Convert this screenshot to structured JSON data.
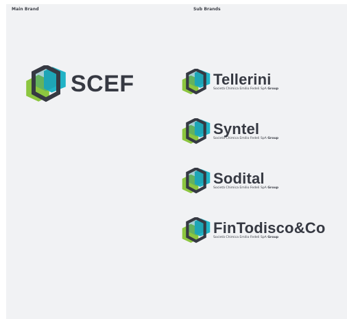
{
  "colors": {
    "background": "#f1f2f4",
    "hex_outline": "#363942",
    "green": "#8cc63f",
    "teal": "#21b3c6",
    "text": "#363942"
  },
  "labels": {
    "main": "Main Brand",
    "sub": "Sub Brands"
  },
  "main_brand": {
    "name": "SCEF",
    "icon": "hexagon-cube-logo-icon"
  },
  "sub_brands": [
    {
      "name": "Tellerini",
      "tagline": "Società Chimica Emilio Fedeli SpA",
      "group": "Group"
    },
    {
      "name": "Syntel",
      "tagline": "Società Chimica Emilio Fedeli SpA",
      "group": "Group"
    },
    {
      "name": "Sodital",
      "tagline": "Società Chimica Emilio Fedeli SpA",
      "group": "Group"
    },
    {
      "name": "FinTodisco&Co",
      "tagline": "Società Chimica Emilio Fedeli SpA",
      "group": "Group"
    }
  ]
}
